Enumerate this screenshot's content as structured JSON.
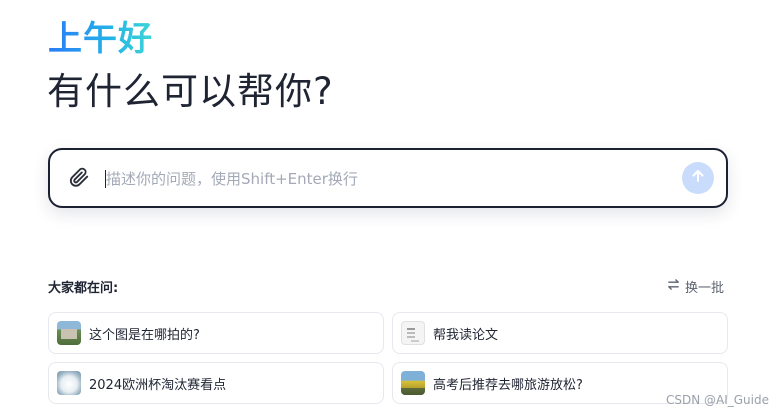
{
  "greeting": "上午好",
  "subtitle": "有什么可以帮你?",
  "composer": {
    "placeholder": "描述你的问题，使用Shift+Enter换行",
    "value": ""
  },
  "suggestions": {
    "heading": "大家都在问:",
    "refresh_label": "换一批",
    "items": [
      {
        "label": "这个图是在哪拍的?",
        "thumb": "landscape-photo"
      },
      {
        "label": "帮我读论文",
        "thumb": "document"
      },
      {
        "label": "2024欧洲杯淘汰赛看点",
        "thumb": "football"
      },
      {
        "label": "高考后推荐去哪旅游放松?",
        "thumb": "train-photo"
      }
    ]
  },
  "watermark": "CSDN @AI_Guide",
  "colors": {
    "accent_gradient_start": "#2a7bf6",
    "accent_gradient_end": "#3fd6d6",
    "send_button": "#c9dcfc",
    "composer_border": "#1c2033"
  }
}
